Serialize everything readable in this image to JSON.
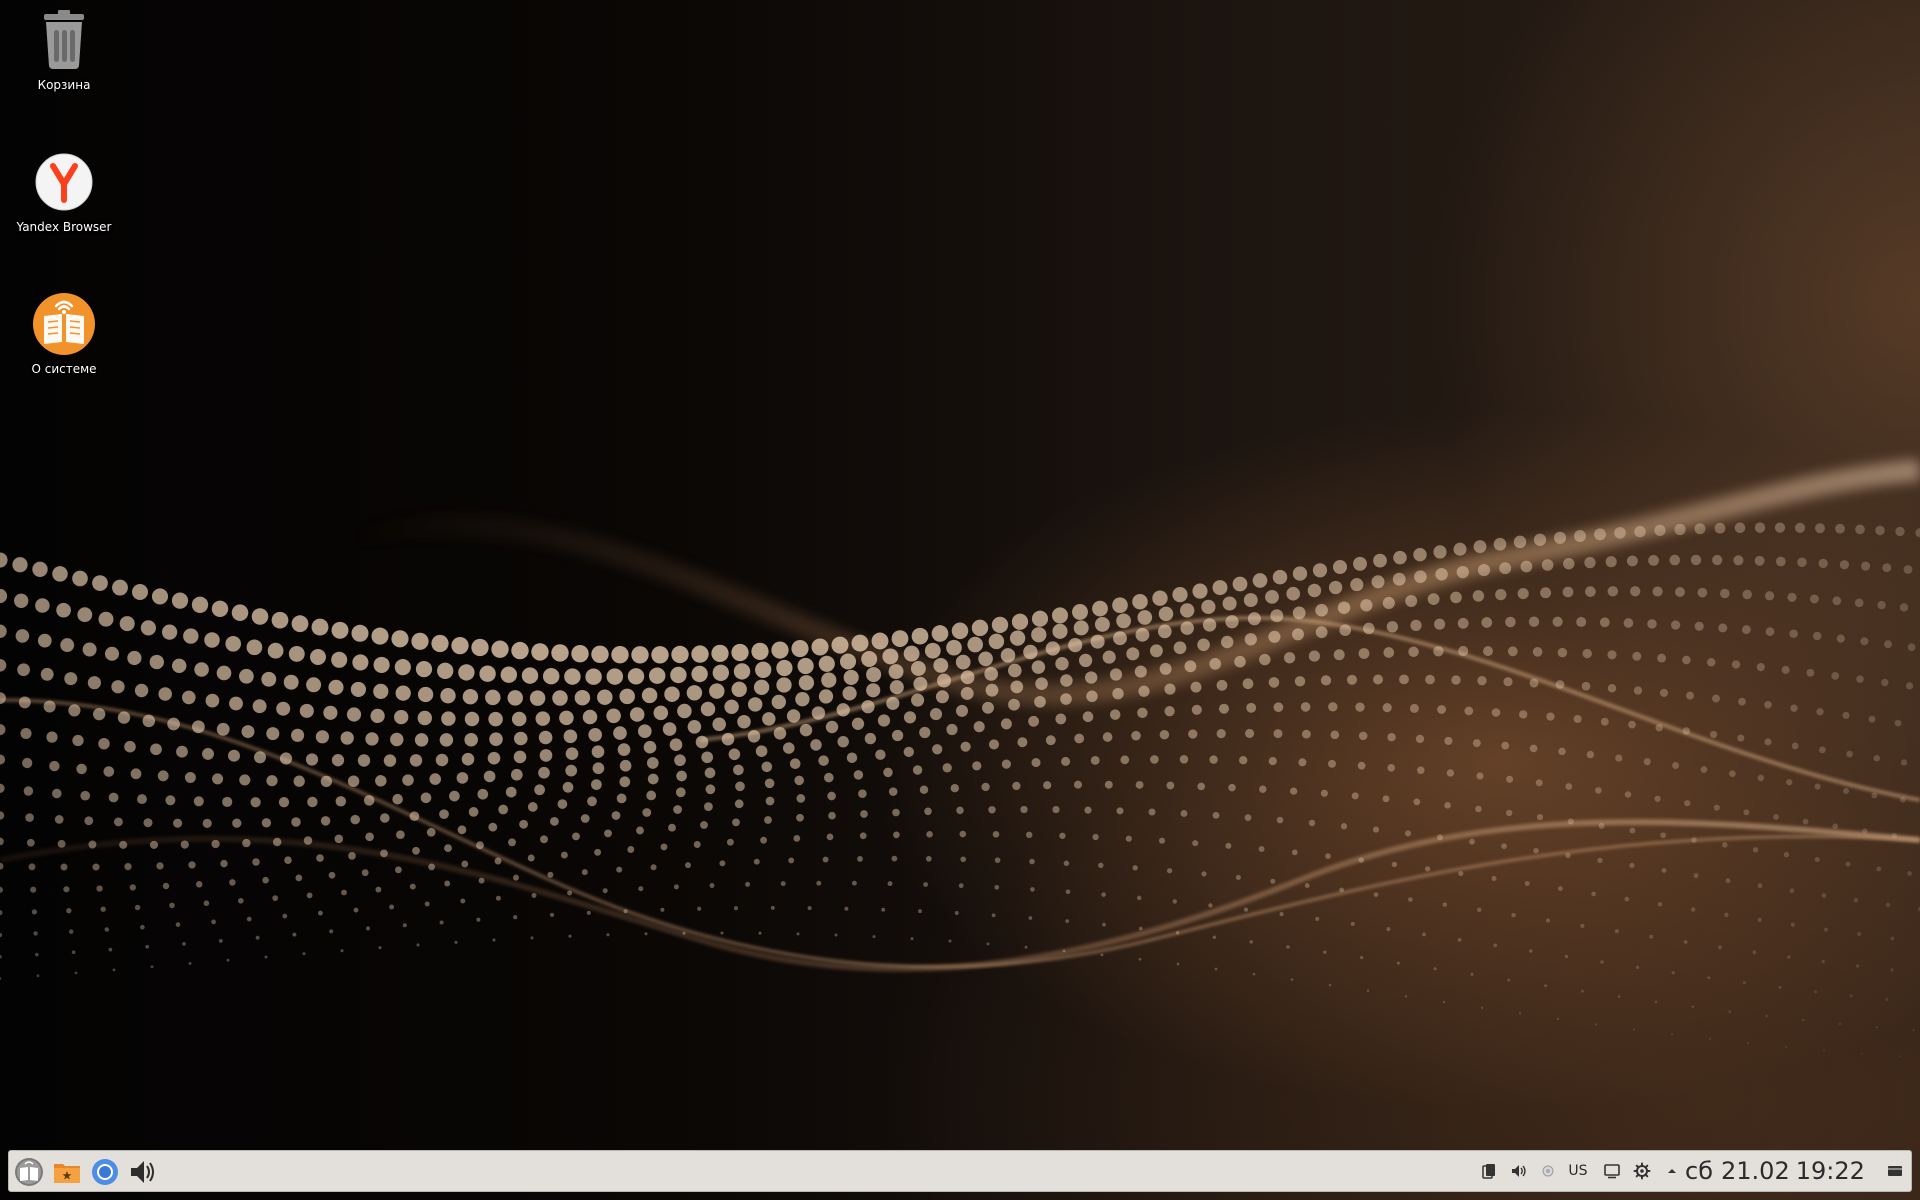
{
  "desktop": {
    "icons": [
      {
        "label": "Корзина",
        "icon": "trash-icon"
      },
      {
        "label": "Yandex Browser",
        "icon": "yandex-browser-icon"
      },
      {
        "label": "О системе",
        "icon": "about-system-icon"
      }
    ]
  },
  "taskbar": {
    "launchers": [
      {
        "icon": "start-menu-icon"
      },
      {
        "icon": "file-manager-icon"
      },
      {
        "icon": "chromium-icon"
      },
      {
        "icon": "volume-icon"
      }
    ],
    "tray": {
      "keyboard_layout": "US",
      "day": "сб",
      "date": "21.02",
      "time": "19:22"
    }
  },
  "colors": {
    "taskbar_bg": "#e3e0dc",
    "accent_orange": "#f2922b",
    "yandex_red": "#fc3f1d"
  }
}
